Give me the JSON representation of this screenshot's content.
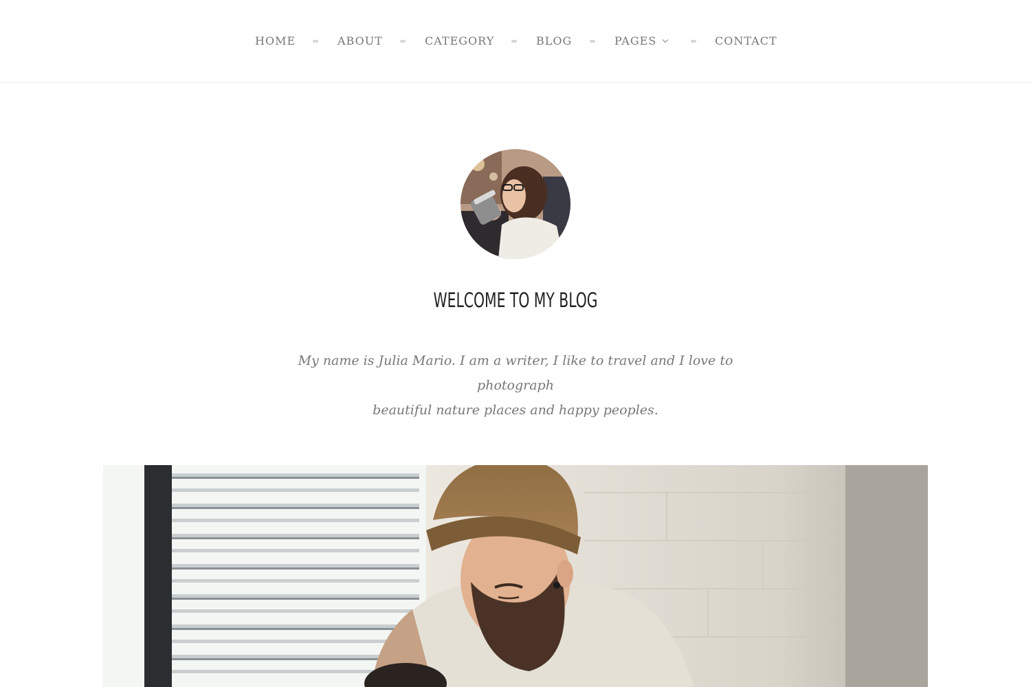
{
  "nav": {
    "items": [
      {
        "label": "HOME"
      },
      {
        "label": "ABOUT"
      },
      {
        "label": "CATEGORY"
      },
      {
        "label": "BLOG"
      },
      {
        "label": "PAGES",
        "has_dropdown": true
      },
      {
        "label": "CONTACT"
      }
    ]
  },
  "intro": {
    "title": "WELCOME TO MY BLOG",
    "description_line1": "My name is Julia Mario. I am a writer, I like to travel and I love to photograph",
    "description_line2": "beautiful nature places and happy peoples."
  },
  "colors": {
    "nav_text": "#777777",
    "title": "#222222",
    "body_text": "#777777",
    "divider": "#ececec"
  }
}
